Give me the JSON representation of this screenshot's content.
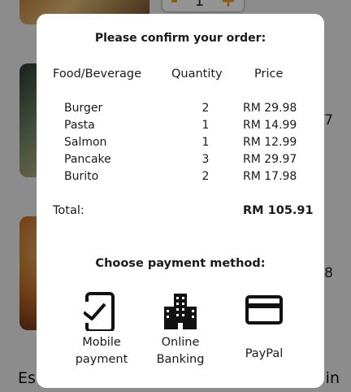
{
  "background": {
    "quantity_value": "1",
    "quantity_minus": "-",
    "quantity_plus": "+",
    "side_number_1": "7",
    "side_number_2": "8",
    "bottom_left_text": "Es",
    "bottom_right_text": "in"
  },
  "modal": {
    "title": "Please confirm your order:",
    "headers": {
      "food": "Food/Beverage",
      "quantity": "Quantity",
      "price": "Price"
    },
    "items": [
      {
        "name": "Burger",
        "quantity": "2",
        "price": "RM 29.98"
      },
      {
        "name": "Pasta",
        "quantity": "1",
        "price": "RM 14.99"
      },
      {
        "name": "Salmon",
        "quantity": "1",
        "price": "RM 12.99"
      },
      {
        "name": "Pancake",
        "quantity": "3",
        "price": "RM 29.97"
      },
      {
        "name": "Burito",
        "quantity": "2",
        "price": "RM 17.98"
      }
    ],
    "total": {
      "label": "Total:",
      "value": "RM 105.91"
    },
    "payment": {
      "title": "Choose payment method:",
      "options": [
        {
          "icon": "mobile-payment-icon",
          "line1": "Mobile",
          "line2": "payment"
        },
        {
          "icon": "bank-building-icon",
          "line1": "Online",
          "line2": "Banking"
        },
        {
          "icon": "credit-card-icon",
          "line1": "PayPal"
        }
      ]
    }
  }
}
